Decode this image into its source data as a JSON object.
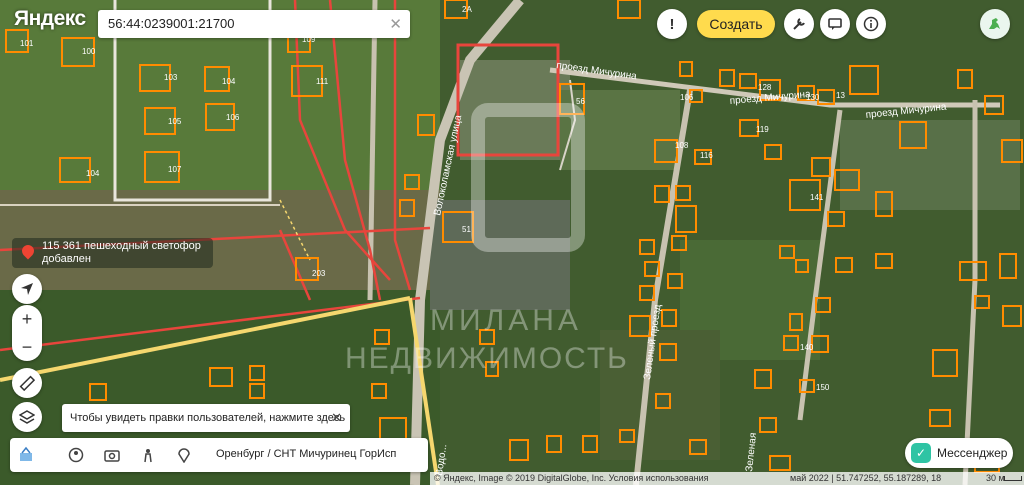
{
  "brand": {
    "logo": "Яндекс"
  },
  "search": {
    "value": "56:44:0239001:21700",
    "clear_icon": "close-icon"
  },
  "toolbar": {
    "create_label": "Создать",
    "buttons": [
      "exclamation-icon",
      "wrench-icon",
      "chat-icon",
      "info-icon",
      "dino-icon"
    ],
    "accent": "#ffdb4d"
  },
  "notice": {
    "line1": "115 361 пешеходный светофор",
    "line2": "добавлен",
    "pin_color": "#ee4433"
  },
  "map_controls": {
    "zoom_in": "+",
    "zoom_out": "−"
  },
  "hint": {
    "text": "Чтобы увидеть правки пользователей, нажмите здесь",
    "close": "✕"
  },
  "bottom_bar": {
    "location": "Оренбург / СНТ Мичуринец ГорИсп"
  },
  "messenger": {
    "label": "Мессенджер"
  },
  "footer": {
    "copyright": "© Яндекс, Image © 2019 DigitalGlobe, Inc. Условия использования",
    "coords": "май 2022 | 51.747252, 55.187289, 18",
    "scale": "30 м"
  },
  "map": {
    "parcel_color": "#ff8c00",
    "boundary_color": "#e8453c",
    "road_color": "#f5d76e",
    "watermark": [
      "МИЛАНА",
      "НЕДВИЖИМОСТЬ"
    ],
    "streets": [
      "проезд Мичурина",
      "проезд Мичурина",
      "проезд Мичурина",
      "Зеленый проезд",
      "Волоколамская улица",
      "Зеленая",
      "Водо..."
    ],
    "labels": [
      "2А",
      "101",
      "100",
      "109",
      "103",
      "104",
      "111",
      "105",
      "106",
      "107",
      "104",
      "203",
      "56",
      "106",
      "128",
      "130",
      "13",
      "119",
      "108",
      "116",
      "141",
      "51",
      "140",
      "150"
    ]
  }
}
